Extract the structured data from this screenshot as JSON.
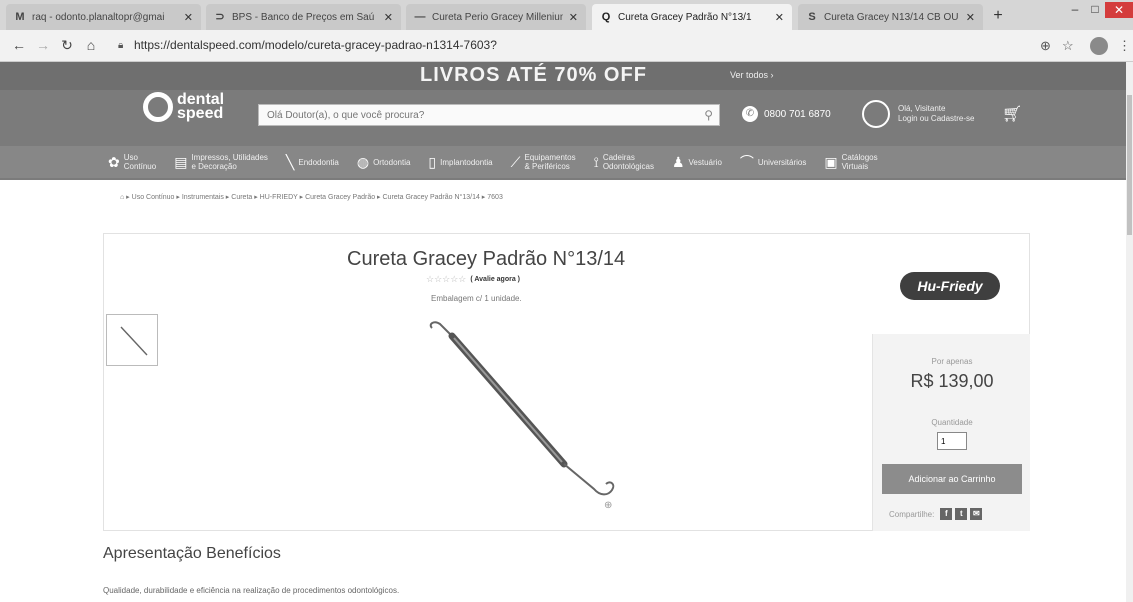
{
  "browser": {
    "tabs": [
      {
        "icon": "M",
        "title": "raq - odonto.planaltopr@gmai",
        "active": false
      },
      {
        "icon": "⊃",
        "title": "BPS - Banco de Preços em Saú",
        "active": false
      },
      {
        "icon": "—",
        "title": "Cureta Perio Gracey Millenium",
        "active": false
      },
      {
        "icon": "Q",
        "title": "Cureta Gracey Padrão N°13/1",
        "active": true
      },
      {
        "icon": "S",
        "title": "Cureta Gracey N13/14 CB OU",
        "active": false
      }
    ],
    "url": "https://dentalspeed.com/modelo/cureta-gracey-padrao-n1314-7603?"
  },
  "site": {
    "banner": "LIVROS ATÉ 70% OFF",
    "banner_cta": "Ver todos ›",
    "logo": {
      "line1": "dental",
      "line2": "speed"
    },
    "search_placeholder": "Olá Doutor(a), o que você procura?",
    "phone": "0800 701 6870",
    "account": {
      "line1": "Olá, Visitante",
      "line2": "Login ou Cadastre-se"
    },
    "categories": [
      {
        "icon": "✿",
        "line1": "Uso",
        "line2": "Contínuo"
      },
      {
        "icon": "▤",
        "line1": "Impressos, Utilidades",
        "line2": "e Decoração"
      },
      {
        "icon": "╲",
        "line1": "Endodontia",
        "line2": ""
      },
      {
        "icon": "◍",
        "line1": "Ortodontia",
        "line2": ""
      },
      {
        "icon": "▯",
        "line1": "Implantodontia",
        "line2": ""
      },
      {
        "icon": "⟋",
        "line1": "Equipamentos",
        "line2": "& Periféricos"
      },
      {
        "icon": "⟟",
        "line1": "Cadeiras",
        "line2": "Odontológicas"
      },
      {
        "icon": "♟",
        "line1": "Vestuário",
        "line2": ""
      },
      {
        "icon": "⌒",
        "line1": "Universitários",
        "line2": ""
      },
      {
        "icon": "▣",
        "line1": "Catálogos",
        "line2": "Virtuais"
      }
    ]
  },
  "breadcrumb": "Uso Contínuo  ▸  Instrumentais  ▸  Cureta  ▸  HU-FRIEDY  ▸  Cureta Gracey Padrão  ▸  Cureta Gracey Padrão N°13/14  ▸  7603",
  "product": {
    "title": "Cureta Gracey Padrão N°13/14",
    "stars": "☆☆☆☆☆",
    "rate_label": "( Avalie agora )",
    "packaging": "Embalagem c/ 1 unidade.",
    "brand": "Hu-Friedy",
    "price_label": "Por apenas",
    "price": "R$ 139,00",
    "qty_label": "Quantidade",
    "qty": "1",
    "add_to_cart": "Adicionar ao Carrinho",
    "share_label": "Compartilhe:"
  },
  "section": {
    "title": "Apresentação Benefícios",
    "text": "Qualidade, durabilidade e eficiência na realização de procedimentos odontológicos."
  }
}
